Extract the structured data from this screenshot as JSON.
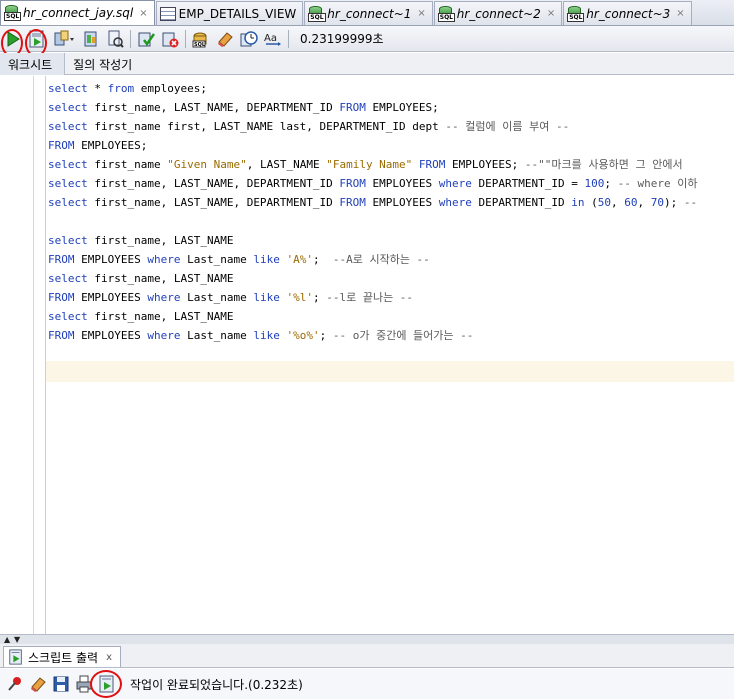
{
  "tabs": [
    {
      "label": "hr_connect_jay.sql",
      "active": true,
      "icon": "sql-worksheet-icon"
    },
    {
      "label": "EMP_DETAILS_VIEW",
      "active": false,
      "icon": "table-view-icon"
    },
    {
      "label": "hr_connect~1",
      "active": false,
      "icon": "sql-worksheet-icon"
    },
    {
      "label": "hr_connect~2",
      "active": false,
      "icon": "sql-worksheet-icon"
    },
    {
      "label": "hr_connect~3",
      "active": false,
      "icon": "sql-worksheet-icon"
    }
  ],
  "tab_close_glyph": "×",
  "toolbar": {
    "timing": "0.23199999초"
  },
  "worksheet_tabs": [
    "워크시트",
    "질의 작성기"
  ],
  "editor": {
    "lines": [
      "select * from employees;",
      "select first_name, LAST_NAME, DEPARTMENT_ID FROM EMPLOYEES;",
      "select first_name first, LAST_NAME last, DEPARTMENT_ID dept -- 컬럼에 이름 부여 --",
      "FROM EMPLOYEES;",
      "select first_name \"Given Name\", LAST_NAME \"Family Name\" FROM EMPLOYEES; --\"\"마크를 사용하면 그 안에서",
      "select first_name, LAST_NAME, DEPARTMENT_ID FROM EMPLOYEES where DEPARTMENT_ID = 100; -- where 이하",
      "select first_name, LAST_NAME, DEPARTMENT_ID FROM EMPLOYEES where DEPARTMENT_ID in (50, 60, 70); --",
      "",
      "select first_name, LAST_NAME",
      "FROM EMPLOYEES where Last_name like 'A%';  --A로 시작하는 --",
      "select first_name, LAST_NAME",
      "FROM EMPLOYEES where Last_name like '%l'; --l로 끝나는 --",
      "select first_name, LAST_NAME",
      "FROM EMPLOYEES where Last_name like '%o%'; -- o가 중간에 들어가는 --"
    ]
  },
  "output": {
    "tab_label": "스크립트 출력",
    "close_glyph": "x",
    "status": "작업이 완료되었습니다.(0.232초)"
  },
  "colors": {
    "keyword": "#1f3fb8",
    "string": "#9a6b00",
    "comment": "#5a5a5a",
    "annotation_circle": "#e01010",
    "current_line": "#fbf6e6"
  }
}
